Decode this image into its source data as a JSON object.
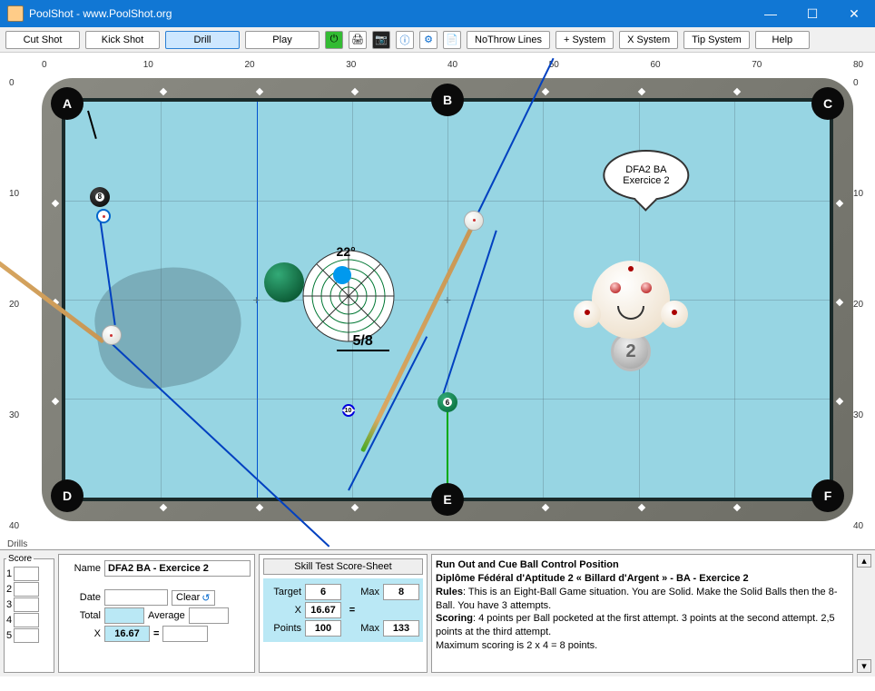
{
  "window": {
    "title": "PoolShot - www.PoolShot.org"
  },
  "toolbar": {
    "cut": "Cut Shot",
    "kick": "Kick Shot",
    "drill": "Drill",
    "play": "Play",
    "nothrow": "NoThrow Lines",
    "plus_sys": "+ System",
    "x_sys": "X System",
    "tip_sys": "Tip System",
    "help": "Help"
  },
  "ruler_x": [
    "0",
    "10",
    "20",
    "30",
    "40",
    "50",
    "60",
    "70",
    "80"
  ],
  "ruler_y": [
    "0",
    "10",
    "20",
    "30",
    "40"
  ],
  "pockets": {
    "a": "A",
    "b": "B",
    "c": "C",
    "d": "D",
    "e": "E",
    "f": "F"
  },
  "sight": {
    "angle": "22°",
    "fraction": "5/8"
  },
  "speech": {
    "line1": "DFA2 BA",
    "line2": "Exercice 2"
  },
  "medal": "2",
  "score": {
    "legend": "Score",
    "rows": [
      "1",
      "2",
      "3",
      "4",
      "5"
    ]
  },
  "info": {
    "name_lbl": "Name",
    "name_val": "DFA2 BA - Exercice 2",
    "date_lbl": "Date",
    "clear": "Clear",
    "total_lbl": "Total",
    "avg_lbl": "Average",
    "x_lbl": "X",
    "x_val": "16.67",
    "eq": "="
  },
  "skill": {
    "btn": "Skill Test Score-Sheet",
    "target_lbl": "Target",
    "target": "6",
    "max_lbl": "Max",
    "max": "8",
    "x_lbl": "X",
    "x": "16.67",
    "eq": "=",
    "pts_lbl": "Points",
    "pts": "100",
    "max2_lbl": "Max",
    "max2": "133"
  },
  "desc": {
    "title": "Run Out and Cue Ball Control Position",
    "subtitle": "Diplôme Fédéral d'Aptitude 2 « Billard d'Argent » - BA - Exercice 2",
    "rules_lbl": "Rules",
    "rules": ": This is an Eight-Ball Game situation. You are Solid. Make the Solid Balls then the 8-Ball. You have 3 attempts.",
    "scoring_lbl": "Scoring",
    "scoring": ": 4 points per Ball pocketed at the first attempt. 3 points at the second attempt. 2,5 points at the third attempt.",
    "max": "Maximum scoring is 2 x 4 = 8 points."
  },
  "stub": "Drills"
}
